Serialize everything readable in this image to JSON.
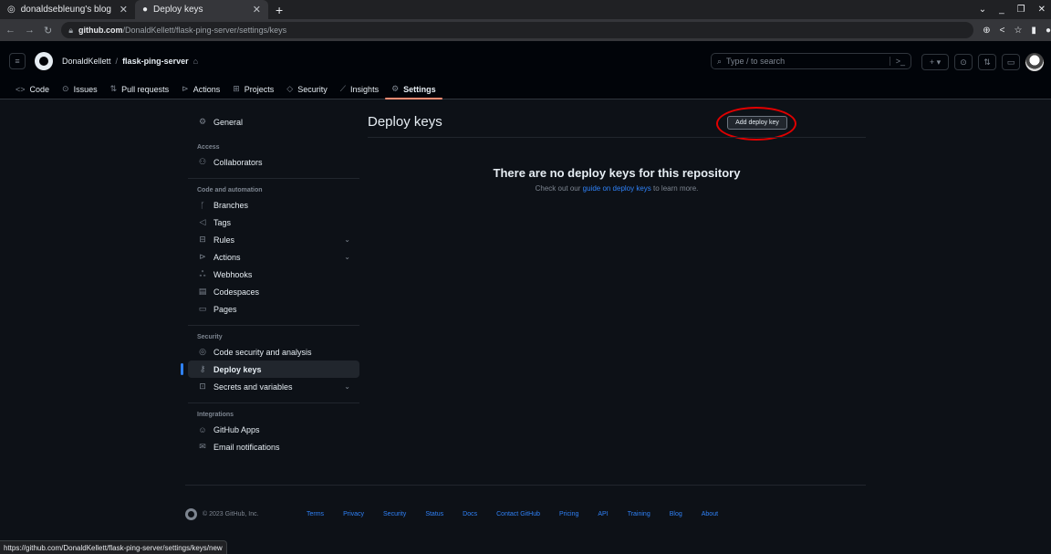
{
  "browser": {
    "tabs": [
      {
        "title": "donaldsebleung's blog",
        "active": false
      },
      {
        "title": "Deploy keys",
        "active": true
      }
    ],
    "new_tab": "+",
    "url_host": "github.com",
    "url_path": "/DonaldKellett/flask-ping-server/settings/keys",
    "status_url": "https://github.com/DonaldKellett/flask-ping-server/settings/keys/new"
  },
  "header": {
    "owner": "DonaldKellett",
    "separator": "/",
    "repo": "flask-ping-server",
    "search_placeholder": "Type / to search",
    "search_cmd": ">_"
  },
  "repo_nav": {
    "tabs": [
      "Code",
      "Issues",
      "Pull requests",
      "Actions",
      "Projects",
      "Security",
      "Insights",
      "Settings"
    ]
  },
  "sidebar": {
    "general": "General",
    "access_heading": "Access",
    "collaborators": "Collaborators",
    "code_heading": "Code and automation",
    "branches": "Branches",
    "tags": "Tags",
    "rules": "Rules",
    "actions": "Actions",
    "webhooks": "Webhooks",
    "codespaces": "Codespaces",
    "pages": "Pages",
    "security_heading": "Security",
    "code_security": "Code security and analysis",
    "deploy_keys": "Deploy keys",
    "secrets": "Secrets and variables",
    "integrations_heading": "Integrations",
    "github_apps": "GitHub Apps",
    "email_notifications": "Email notifications"
  },
  "main": {
    "title": "Deploy keys",
    "add_button": "Add deploy key",
    "blank_title": "There are no deploy keys for this repository",
    "blank_pre": "Check out our ",
    "blank_link": "guide on deploy keys",
    "blank_post": " to learn more."
  },
  "footer": {
    "copyright": "© 2023 GitHub, Inc.",
    "links": [
      "Terms",
      "Privacy",
      "Security",
      "Status",
      "Docs",
      "Contact GitHub",
      "Pricing",
      "API",
      "Training",
      "Blog",
      "About"
    ]
  },
  "colors": {
    "background": "#0d1117",
    "accent_link": "#2f81f7",
    "selected_underline": "#fd8c73",
    "annotation_ring": "#e00000"
  }
}
